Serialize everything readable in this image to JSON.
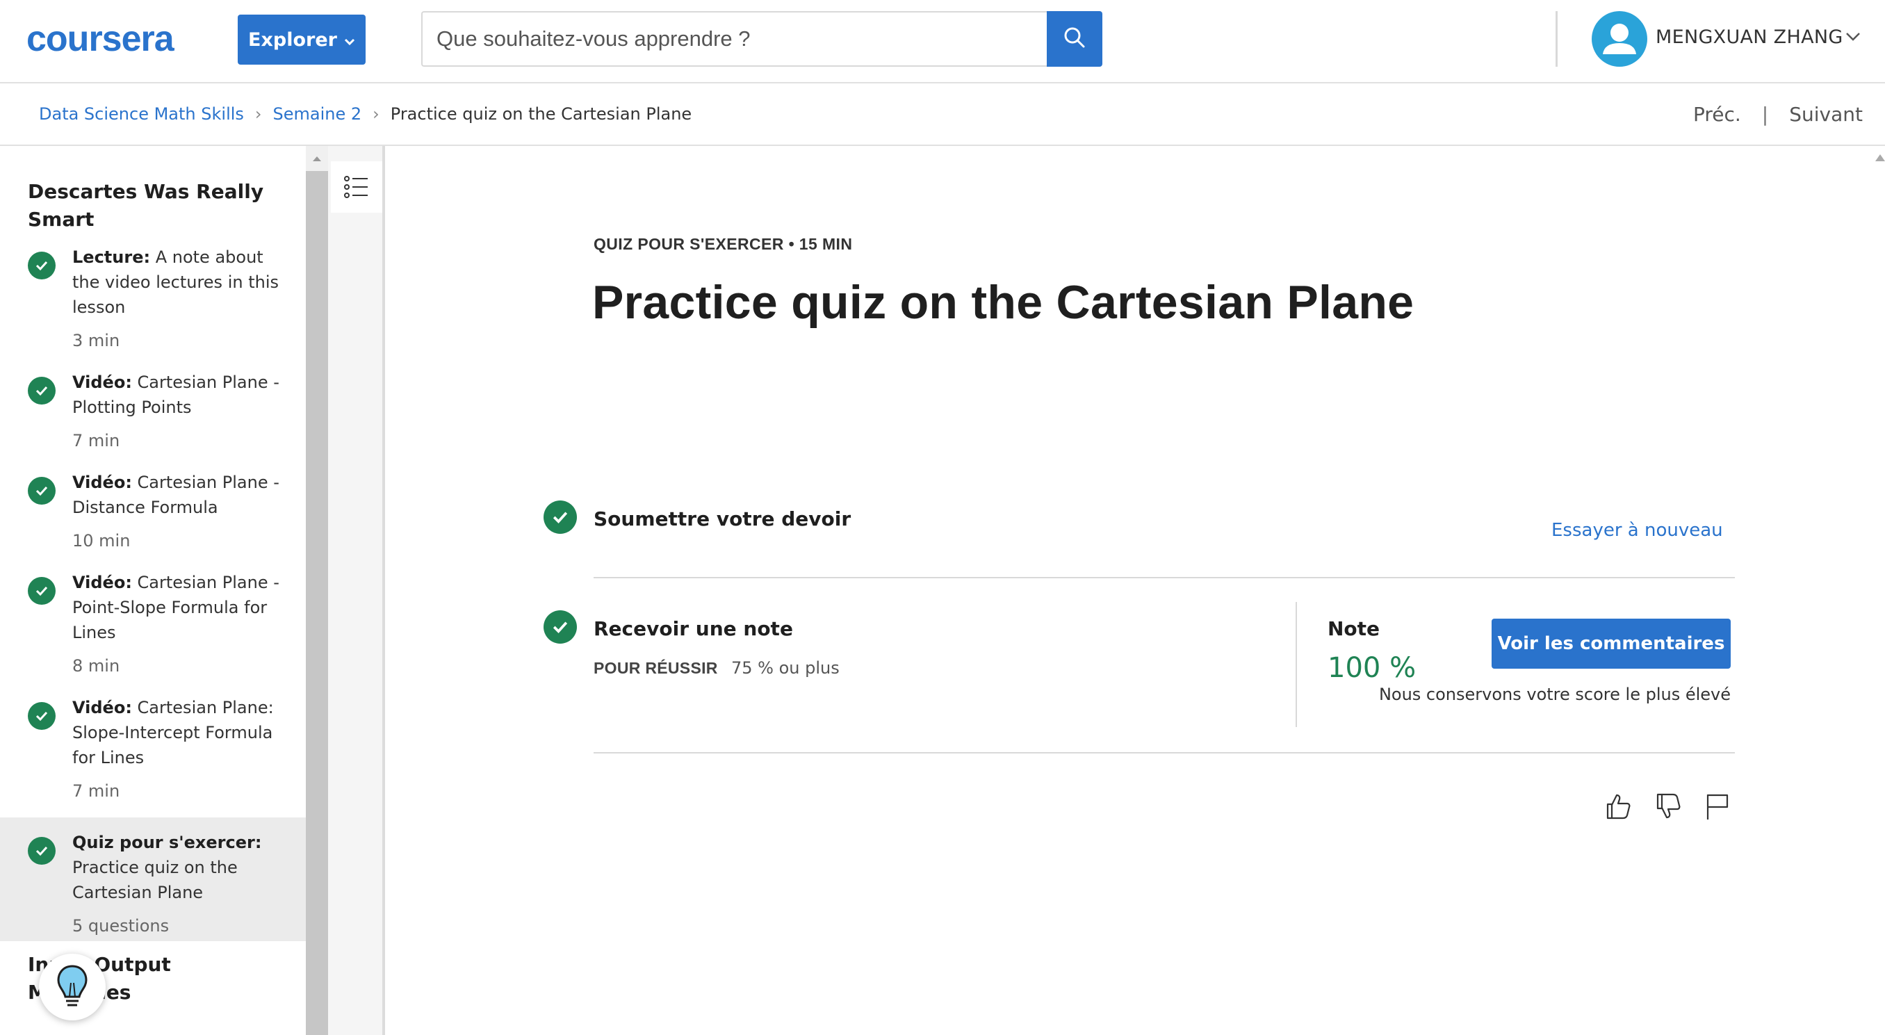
{
  "header": {
    "logo": "coursera",
    "explore_label": "Explorer",
    "search_placeholder": "Que souhaitez-vous apprendre ?",
    "user_name": "MENGXUAN ZHANG"
  },
  "breadcrumb": {
    "items": [
      "Data Science Math Skills",
      "Semaine 2",
      "Practice quiz on the Cartesian Plane"
    ],
    "separator": "›",
    "prev_label": "Préc.",
    "divider": "|",
    "next_label": "Suivant"
  },
  "sidebar": {
    "section_title": "Descartes Was Really Smart",
    "items": [
      {
        "type_label": "Lecture:",
        "title": " A note about the video lectures in this lesson",
        "duration": "3  min",
        "completed": true,
        "active": false
      },
      {
        "type_label": "Vidéo:",
        "title": " Cartesian Plane - Plotting Points",
        "duration": "7  min",
        "completed": true,
        "active": false
      },
      {
        "type_label": "Vidéo:",
        "title": " Cartesian Plane - Distance Formula",
        "duration": "10  min",
        "completed": true,
        "active": false
      },
      {
        "type_label": "Vidéo:",
        "title": " Cartesian Plane - Point-Slope Formula for Lines",
        "duration": "8  min",
        "completed": true,
        "active": false
      },
      {
        "type_label": "Vidéo:",
        "title": " Cartesian Plane: Slope-Intercept Formula for Lines",
        "duration": "7  min",
        "completed": true,
        "active": false
      },
      {
        "type_label": "Quiz pour s'exercer:",
        "title": " Practice quiz on the Cartesian Plane",
        "duration": "5 questions",
        "completed": true,
        "active": true
      }
    ],
    "next_section_title": "Input-Output Machines"
  },
  "main": {
    "eyebrow": "QUIZ POUR S'EXERCER • 15  MIN",
    "title": "Practice quiz on the Cartesian Plane",
    "submit_step": {
      "title": "Soumettre votre devoir",
      "retry_label": "Essayer à nouveau"
    },
    "grade_step": {
      "title": "Recevoir une note",
      "pass_label": "POUR RÉUSSIR",
      "pass_value": "75 % ou plus",
      "grade_label": "Note",
      "grade_value": "100 %",
      "feedback_button": "Voir les commentaires",
      "keep_note": "Nous conservons votre score le plus élevé"
    }
  },
  "colors": {
    "brand_blue": "#2a73cc",
    "success_green": "#1f8354",
    "avatar_blue": "#2aa3d9"
  },
  "icons": [
    "search-icon",
    "chevron-down-icon",
    "user-avatar-icon",
    "checkmark-icon",
    "list-icon",
    "lightbulb-icon",
    "thumbs-up-icon",
    "thumbs-down-icon",
    "flag-icon"
  ]
}
